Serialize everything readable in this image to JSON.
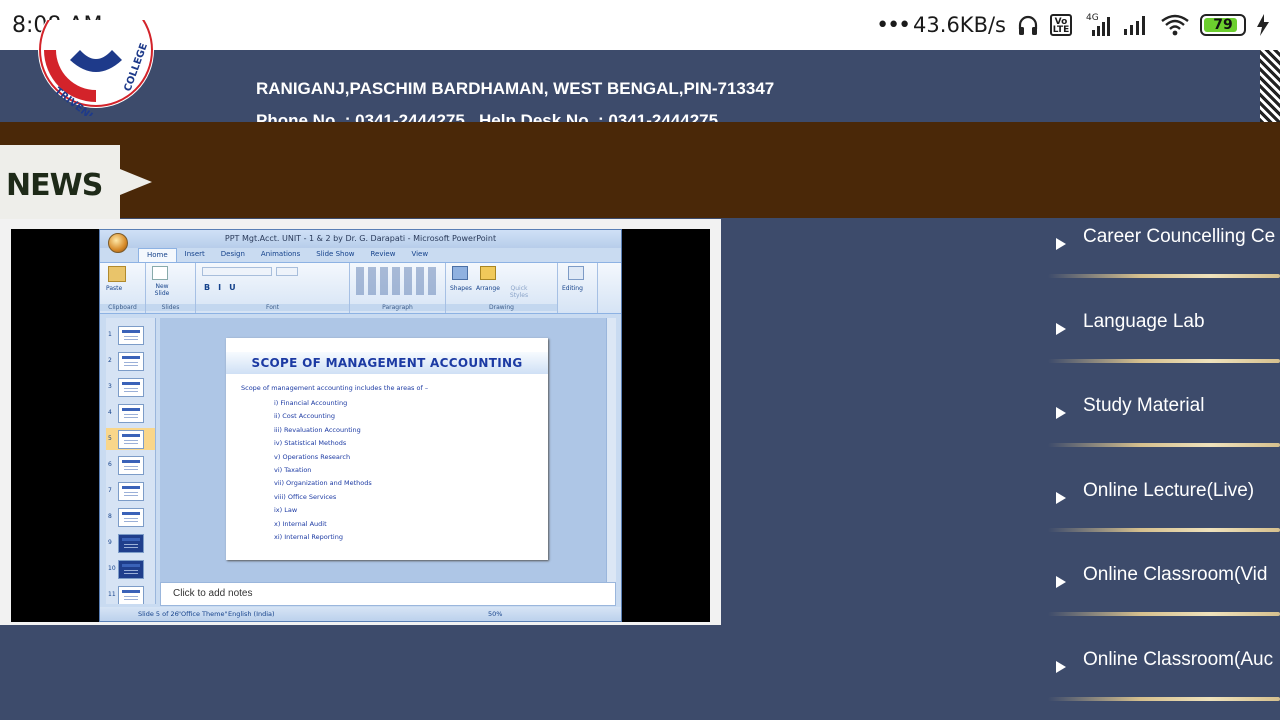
{
  "status_bar": {
    "time": "8:08 AM",
    "network_speed": "43.6KB/s",
    "network_type": "4G",
    "volte": "Vo LTE",
    "battery_level": "79",
    "icons": [
      "headphones-icon",
      "volte-icon",
      "signal-icon",
      "wifi-icon",
      "battery-icon",
      "charging-icon"
    ]
  },
  "header": {
    "college_name": "TRIVENI DEVI BHALOTIA COLLEGE",
    "address": "RANIGANJ,PASCHIM BARDHAMAN, WEST BENGAL,PIN-713347",
    "phone": "Phone No. : 0341-2444275   Help Desk No. : 0341-2444275"
  },
  "news": {
    "label": "NEWS"
  },
  "video": {
    "ppt": {
      "window_title": "PPT Mgt.Acct. UNIT - 1 & 2 by Dr. G. Darapati - Microsoft PowerPoint",
      "tabs": [
        "Home",
        "Insert",
        "Design",
        "Animations",
        "Slide Show",
        "Review",
        "View"
      ],
      "ribbon_groups": [
        "Clipboard",
        "Slides",
        "Font",
        "Paragraph",
        "Drawing",
        "Editing"
      ],
      "ribbon_buttons": {
        "paste": "Paste",
        "new_slide": "New Slide",
        "shapes": "Shapes",
        "arrange": "Arrange",
        "quick_styles": "Quick Styles",
        "editing": "Editing"
      },
      "thumbnails": [
        "1",
        "2",
        "3",
        "4",
        "5",
        "6",
        "7",
        "8",
        "9",
        "10",
        "11"
      ],
      "selected_thumbnail": 5,
      "slide": {
        "title": "SCOPE OF MANAGEMENT ACCOUNTING",
        "intro": "Scope of management accounting includes the areas of –",
        "items": [
          "i) Financial Accounting",
          "ii) Cost Accounting",
          "iii) Revaluation Accounting",
          "iv) Statistical Methods",
          "v) Operations Research",
          "vi) Taxation",
          "vii) Organization and Methods",
          "viii) Office Services",
          "ix) Law",
          "x) Internal Audit",
          "xi) Internal Reporting"
        ]
      },
      "notes_placeholder": "Click to add notes",
      "status": {
        "slide": "Slide 5 of 26",
        "theme": "\"Office Theme\"",
        "language": "English (India)",
        "zoom": "50%"
      }
    }
  },
  "menu": {
    "items": [
      {
        "label": "Career Councelling Ce"
      },
      {
        "label": "Language Lab"
      },
      {
        "label": "Study Material"
      },
      {
        "label": "Online Lecture(Live)"
      },
      {
        "label": "Online Classroom(Vid"
      },
      {
        "label": "Online Classroom(Auc"
      }
    ]
  },
  "colors": {
    "page_bg": "#3d4b6b",
    "news_band": "#4a2808",
    "menu_divider": "#e0ceA0",
    "slide_text": "#1c3aa3"
  }
}
